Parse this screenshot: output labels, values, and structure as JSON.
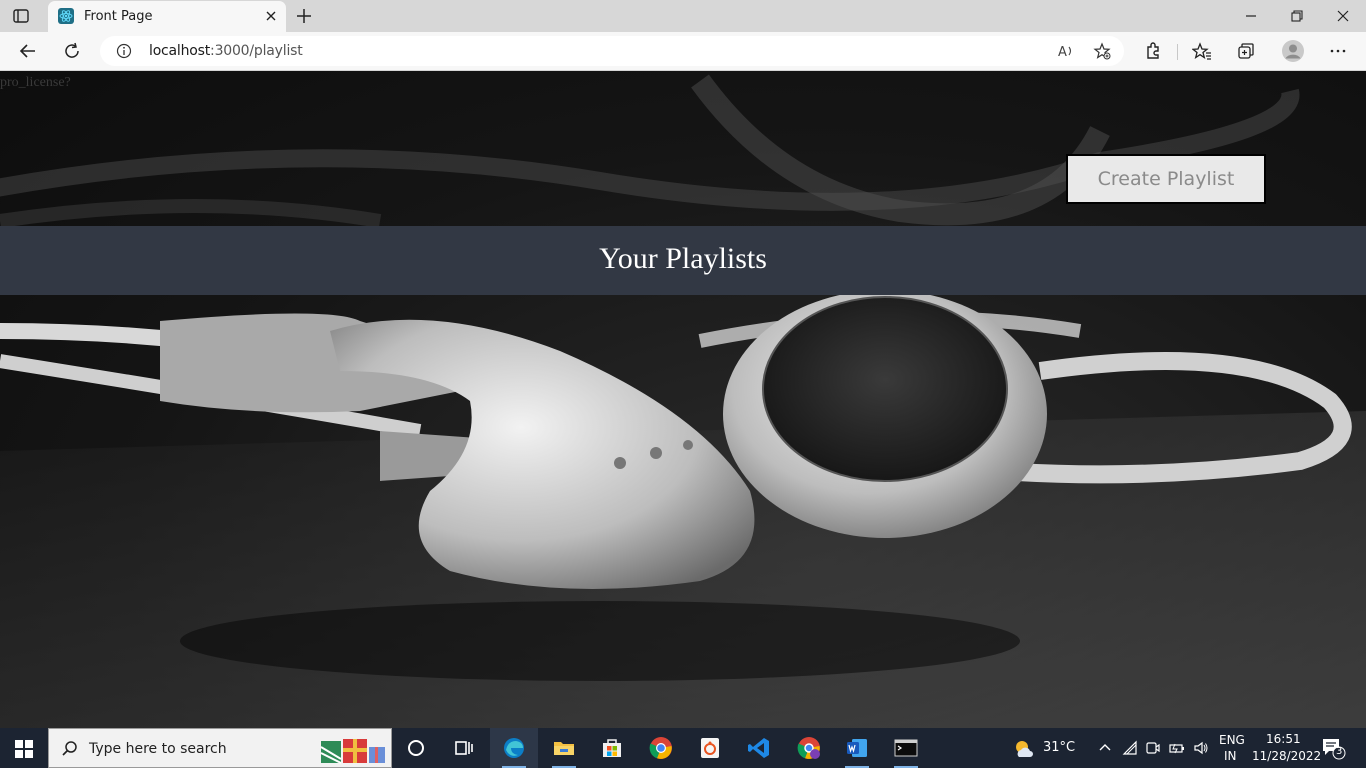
{
  "browser": {
    "tab_title": "Front Page",
    "url_host": "localhost",
    "url_rest": ":3000/playlist"
  },
  "page": {
    "license_text": "pro_license?",
    "create_button_label": "Create Playlist",
    "heading": "Your Playlists"
  },
  "taskbar": {
    "search_placeholder": "Type here to search",
    "weather_temp": "31°C",
    "lang_line1": "ENG",
    "lang_line2": "IN",
    "time": "16:51",
    "date": "11/28/2022",
    "notification_count": "3",
    "apps": [
      "task-view",
      "edge",
      "file-explorer",
      "microsoft-store",
      "chrome",
      "ubuntu-app",
      "vscode",
      "chrome-profile",
      "word",
      "terminal"
    ]
  },
  "colors": {
    "header_band": "#323844",
    "taskbar": "#1c2432",
    "button_bg": "#e9e9e9"
  }
}
